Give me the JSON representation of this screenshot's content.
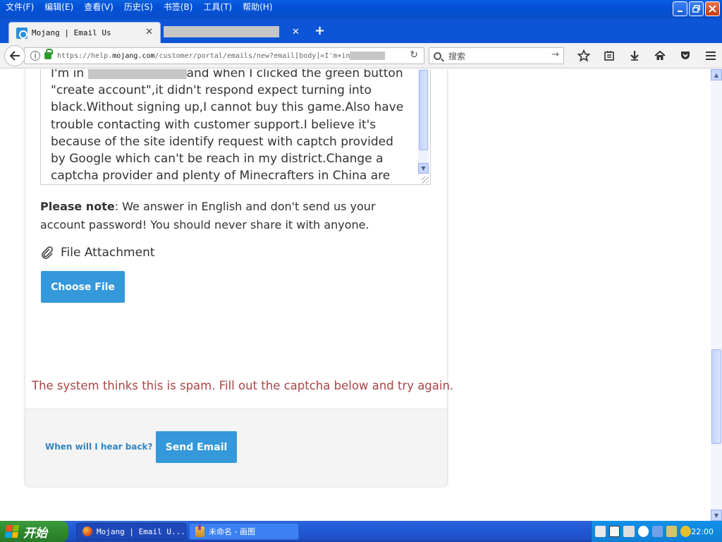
{
  "window": {
    "menu": [
      "文件(F)",
      "编辑(E)",
      "查看(V)",
      "历史(S)",
      "书签(B)",
      "工具(T)",
      "帮助(H)"
    ]
  },
  "tabs": {
    "active_title": "Mojang | Email Us",
    "close_glyph": "✕",
    "new_tab_glyph": "+"
  },
  "navbar": {
    "url_prefix": "https://help.",
    "url_domain": "mojang.com",
    "url_path": "/customer/portal/emails/new?email[body]=I'm+in",
    "search_placeholder": "搜索",
    "search_go": "→",
    "reload": "↻"
  },
  "form": {
    "body_lines": [
      "I'm in",
      "and when I clicked the green button \"create account\",it didn't respond expect turning into black.Without signing up,I cannot buy this game.Also have trouble contacting with customer support.I believe it's because of the site identify request with captch provided by Google which can't be reach in my district.Change a captcha provider and plenty of Minecrafters in China are able to buy"
    ],
    "note_bold": "Please note",
    "note_text": ": We answer in English and don't send us your account password! You should never share it with anyone.",
    "attachment_label": "File Attachment",
    "choose_file": "Choose File",
    "spam_message": "The system thinks this is spam. Fill out the captcha below and try again.",
    "hear_back": "When will I hear back?",
    "send": "Send Email"
  },
  "taskbar": {
    "start": "开始",
    "task_firefox": "Mojang | Email U...",
    "task_paint": "未命名 - 画图",
    "clock": "22:00"
  },
  "colors": {
    "accent_button": "#3498db",
    "error_text": "#a94442",
    "link": "#2f86c4"
  }
}
